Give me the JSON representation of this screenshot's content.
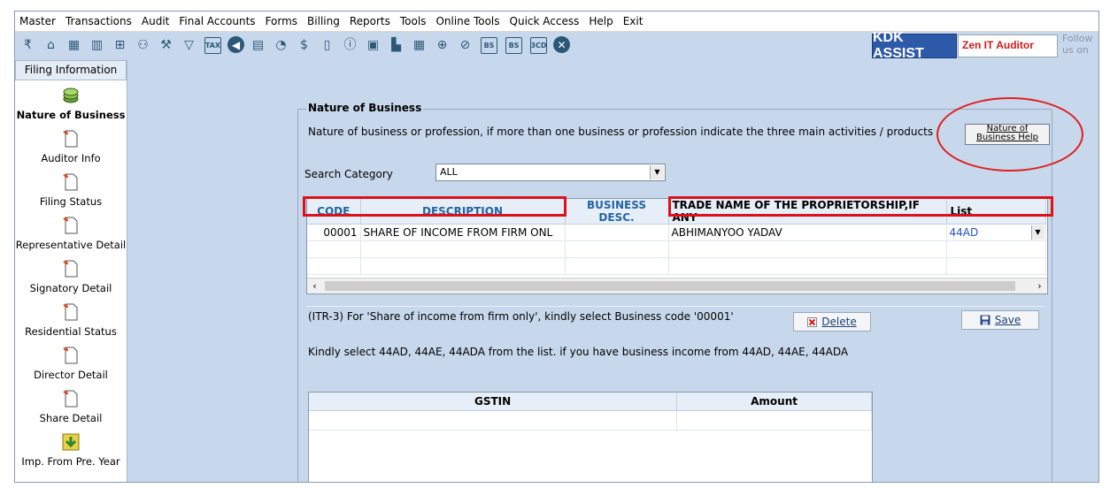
{
  "menu": [
    "Master",
    "Transactions",
    "Audit",
    "Final Accounts",
    "Forms",
    "Billing",
    "Reports",
    "Tools",
    "Online Tools",
    "Quick Access",
    "Help",
    "Exit"
  ],
  "toolbar": {
    "kdk_assist": "KDK ASSIST",
    "zen_it_auditor": "Zen IT Auditor",
    "follow_line1": "Follow",
    "follow_line2": "us on"
  },
  "sidebar": {
    "header": "Filing Information",
    "items": [
      {
        "label": "Nature of Business",
        "active": true
      },
      {
        "label": "Auditor Info"
      },
      {
        "label": "Filing Status"
      },
      {
        "label": "Representative Detail"
      },
      {
        "label": "Signatory Detail"
      },
      {
        "label": "Residential Status"
      },
      {
        "label": "Director Detail"
      },
      {
        "label": "Share Detail"
      },
      {
        "label": "Imp. From Pre. Year"
      }
    ]
  },
  "main": {
    "group_title": "Nature of Business",
    "instruction": "Nature of business or profession, if more than one business or profession indicate the three main activities / products",
    "help_button_line1": "Nature of",
    "help_button_line2": "Business Help",
    "search_label": "Search Category",
    "search_value": "ALL",
    "grid": {
      "columns": [
        "CODE",
        "DESCRIPTION",
        "BUSINESS DESC.",
        "TRADE NAME OF THE PROPRIETORSHIP,IF ANY",
        "List"
      ],
      "rows": [
        {
          "code": "00001",
          "description": "SHARE OF INCOME FROM FIRM ONL",
          "business_desc": "",
          "trade_name": "ABHIMANYOO YADAV",
          "list": "44AD"
        }
      ]
    },
    "note_itr3": "(ITR-3) For 'Share of income from firm only', kindly select Business code '00001'",
    "note_44": "Kindly select 44AD, 44AE, 44ADA from the list. if you have business income from 44AD, 44AE, 44ADA",
    "delete_label": "Delete",
    "save_label": "Save",
    "gst_table": {
      "columns": [
        "GSTIN",
        "Amount"
      ]
    }
  },
  "colors": {
    "background": "#c8d8ec",
    "accent_blue": "#2464a4",
    "highlight_red": "#e0101a",
    "kdk_button": "#2d5aa8"
  }
}
